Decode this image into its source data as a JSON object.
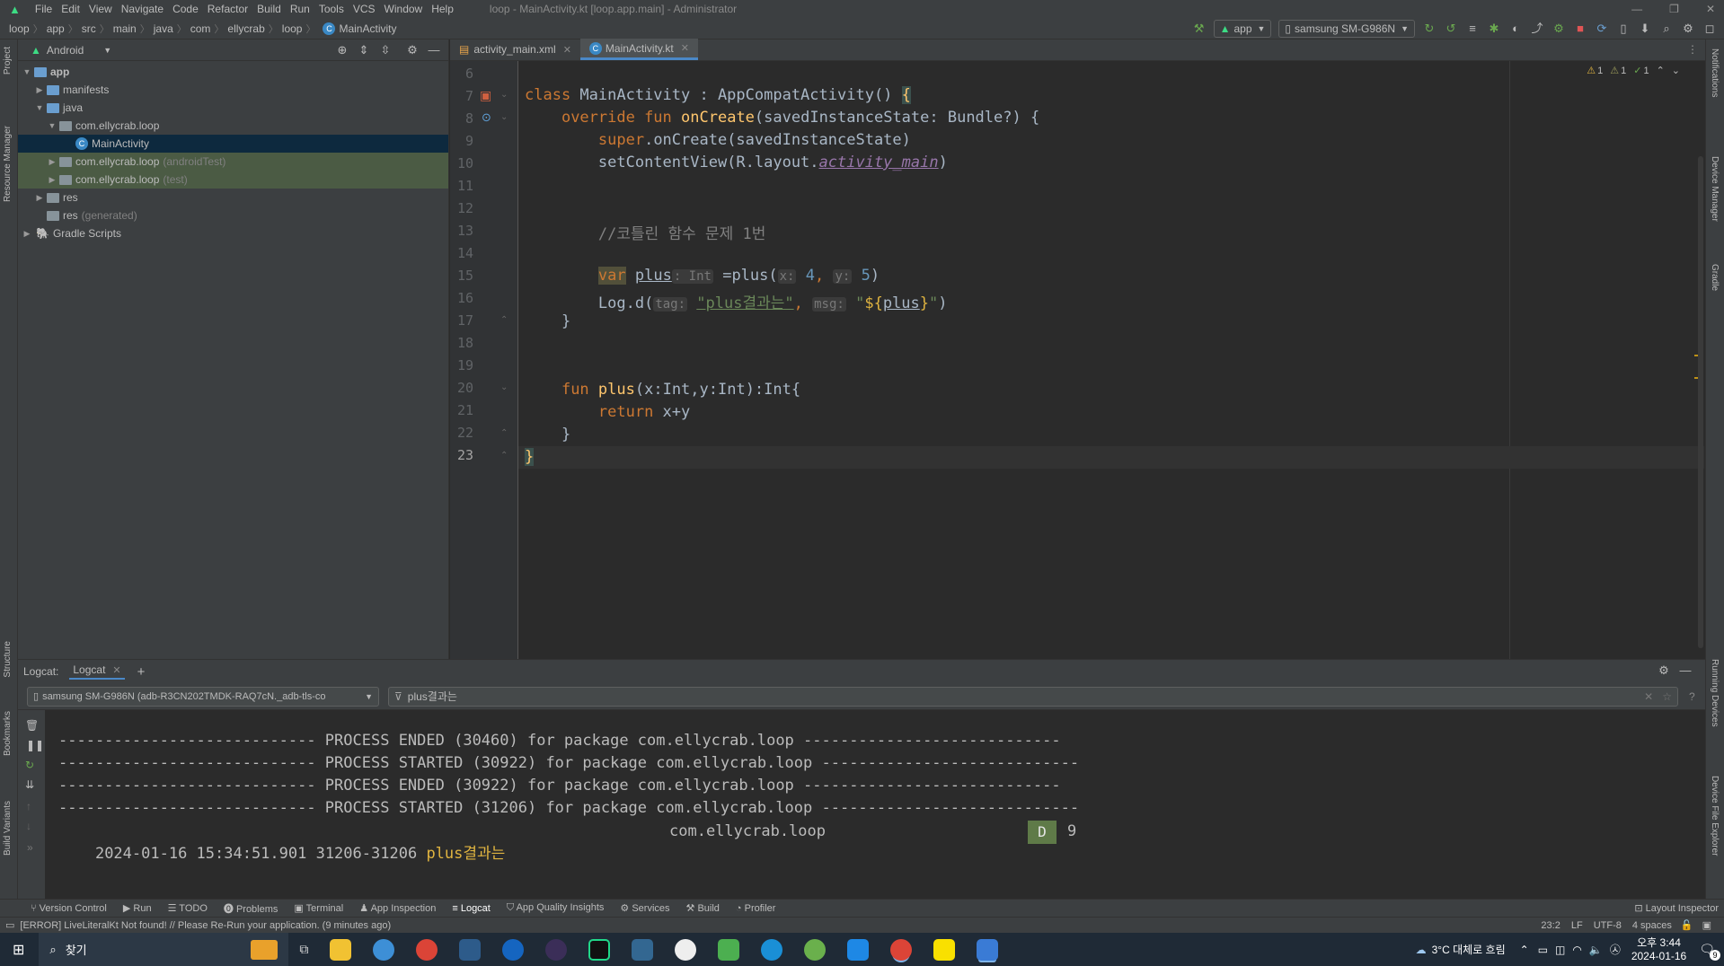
{
  "menu": {
    "items": [
      "File",
      "Edit",
      "View",
      "Navigate",
      "Code",
      "Refactor",
      "Build",
      "Run",
      "Tools",
      "VCS",
      "Window",
      "Help"
    ],
    "window_title": "loop - MainActivity.kt [loop.app.main] - Administrator"
  },
  "breadcrumbs": [
    "loop",
    "app",
    "src",
    "main",
    "java",
    "com",
    "ellycrab",
    "loop",
    "MainActivity"
  ],
  "toolbar": {
    "run_config": "app",
    "device": "samsung SM-G986N"
  },
  "project": {
    "view": "Android",
    "tree": [
      {
        "label": "app",
        "suffix": ""
      },
      {
        "label": "manifests",
        "suffix": ""
      },
      {
        "label": "java",
        "suffix": ""
      },
      {
        "label": "com.ellycrab.loop",
        "suffix": ""
      },
      {
        "label": "MainActivity",
        "suffix": ""
      },
      {
        "label": "com.ellycrab.loop",
        "suffix": "(androidTest)"
      },
      {
        "label": "com.ellycrab.loop",
        "suffix": "(test)"
      },
      {
        "label": "res",
        "suffix": ""
      },
      {
        "label": "res",
        "suffix": "(generated)"
      },
      {
        "label": "Gradle Scripts",
        "suffix": ""
      }
    ]
  },
  "editor": {
    "tabs": [
      "activity_main.xml",
      "MainActivity.kt"
    ],
    "inspections": {
      "warnings": "1",
      "weak_warnings": "1",
      "ok": "1"
    },
    "line_numbers": [
      "6",
      "7",
      "8",
      "9",
      "10",
      "11",
      "12",
      "13",
      "14",
      "15",
      "16",
      "17",
      "18",
      "19",
      "20",
      "21",
      "22",
      "23"
    ],
    "code": {
      "l7_kw": "class",
      "l7_rest": " MainActivity : AppCompatActivity() ",
      "l7_brace": "{",
      "l8_kw": "override fun",
      "l8_fn": "onCreate",
      "l8_rest": "(savedInstanceState: Bundle?) {",
      "l9_kw": "super",
      "l9_rest": ".onCreate(savedInstanceState)",
      "l10_a": "setContentView(R.layout.",
      "l10_it": "activity_main",
      "l10_b": ")",
      "l13_cm": "//코틀린 함수 문제 1번",
      "l15_kw": "var",
      "l15_var": "plus",
      "l15_hint_type": ": Int",
      "l15_a": " =plus(",
      "l15_hint_x": "x:",
      "l15_x": "4",
      "l15_comma": ", ",
      "l15_hint_y": "y:",
      "l15_y": "5",
      "l15_b": ")",
      "l16_a": "Log.d(",
      "l16_hint_tag": "tag:",
      "l16_str": "\"plus결과는\"",
      "l16_comma": ", ",
      "l16_hint_msg": "msg:",
      "l16_q1": "\"",
      "l16_tmpl": "${",
      "l16_var": "plus",
      "l16_tmpl_end": "}",
      "l16_q2": "\"",
      "l16_b": ")",
      "l17": "}",
      "l20_kw": "fun",
      "l20_fn": "plus",
      "l20_rest": "(x:Int,y:Int):Int{",
      "l21_kw": "return",
      "l21_rest": " x+y",
      "l22": "}",
      "l23": "}"
    }
  },
  "logcat": {
    "label": "Logcat:",
    "tab": "Logcat",
    "device": "samsung SM-G986N (adb-R3CN202TMDK-RAQ7cN._adb-tls-co",
    "filter": "plus결과는",
    "lines": [
      "---------------------------- PROCESS ENDED (30460) for package com.ellycrab.loop ----------------------------",
      "---------------------------- PROCESS STARTED (30922) for package com.ellycrab.loop ----------------------------",
      "---------------------------- PROCESS ENDED (30922) for package com.ellycrab.loop ----------------------------",
      "---------------------------- PROCESS STARTED (31206) for package com.ellycrab.loop ----------------------------"
    ],
    "entry": {
      "timestamp": "2024-01-16 15:34:51.901 31206-31206",
      "tag": "plus결과는",
      "package": "com.ellycrab.loop",
      "level": "D",
      "message": "9"
    }
  },
  "left_tools": [
    "Project",
    "Resource Manager",
    "Structure",
    "Bookmarks",
    "Build Variants"
  ],
  "right_tools": [
    "Notifications",
    "Device Manager",
    "Gradle",
    "Running Devices",
    "Device File Explorer"
  ],
  "tool_windows": [
    "Version Control",
    "Run",
    "TODO",
    "Problems",
    "Terminal",
    "App Inspection",
    "Logcat",
    "App Quality Insights",
    "Services",
    "Build",
    "Profiler"
  ],
  "layout_inspector": "Layout Inspector",
  "status": {
    "message": "[ERROR] LiveLiteralKt Not found! // Please Re-Run your application. (9 minutes ago)",
    "position": "23:2",
    "line_sep": "LF",
    "encoding": "UTF-8",
    "indent": "4 spaces"
  },
  "taskbar": {
    "search": "찾기",
    "weather": "3°C  대체로 흐림",
    "time": "오후 3:44",
    "date": "2024-01-16",
    "badge": "9"
  },
  "colors": {
    "keyword": "#cc7832",
    "function": "#ffc66d",
    "string": "#6a8759",
    "comment": "#808080",
    "number": "#6897bb",
    "accent": "#4a88c7"
  }
}
